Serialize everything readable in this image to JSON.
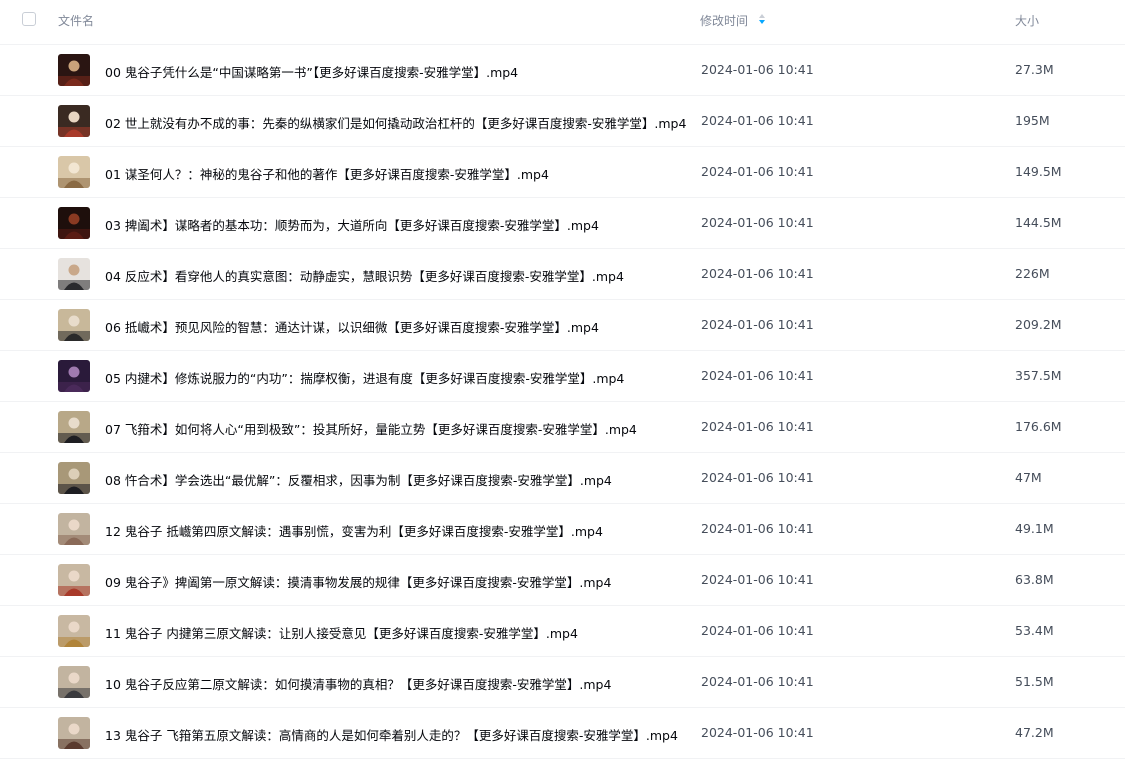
{
  "header": {
    "name_label": "文件名",
    "time_label": "修改时间",
    "size_label": "大小"
  },
  "files": [
    {
      "name": "00 鬼谷子凭什么是“中国谋略第一书”【更多好课百度搜索-安雅学堂】.mp4",
      "time": "2024-01-06 10:41",
      "size": "27.3M",
      "thumb": [
        "#2a1512",
        "#7a2a1c",
        "#c9a27a"
      ]
    },
    {
      "name": "02 世上就没有办不成的事：先秦的纵横家们是如何撬动政治杠杆的【更多好课百度搜索-安雅学堂】.mp4",
      "time": "2024-01-06 10:41",
      "size": "195M",
      "thumb": [
        "#3a2a22",
        "#a83a2a",
        "#e8d6c2"
      ]
    },
    {
      "name": "01 谋圣何人？：神秘的鬼谷子和他的著作【更多好课百度搜索-安雅学堂】.mp4",
      "time": "2024-01-06 10:41",
      "size": "149.5M",
      "thumb": [
        "#d9c7a8",
        "#8a6a44",
        "#f2e6d2"
      ]
    },
    {
      "name": "03 捭阖术】谋略者的基本功：顺势而为，大道所向【更多好课百度搜索-安雅学堂】.mp4",
      "time": "2024-01-06 10:41",
      "size": "144.5M",
      "thumb": [
        "#1e0f0c",
        "#5a1c14",
        "#8a3a22"
      ]
    },
    {
      "name": "04 反应术】看穿他人的真实意图：动静虚实，慧眼识势【更多好课百度搜索-安雅学堂】.mp4",
      "time": "2024-01-06 10:41",
      "size": "226M",
      "thumb": [
        "#e6e2de",
        "#2a2a2e",
        "#c9a88a"
      ]
    },
    {
      "name": "06 抵巇术】预见风险的智慧：通达计谋，以识细微【更多好课百度搜索-安雅学堂】.mp4",
      "time": "2024-01-06 10:41",
      "size": "209.2M",
      "thumb": [
        "#c8b89a",
        "#2a2a2a",
        "#e8dccb"
      ]
    },
    {
      "name": "05 内揵术】修炼说服力的“内功”：揣摩权衡，进退有度【更多好课百度搜索-安雅学堂】.mp4",
      "time": "2024-01-06 10:41",
      "size": "357.5M",
      "thumb": [
        "#2a1a3a",
        "#4a2a5a",
        "#a07ab0"
      ]
    },
    {
      "name": "07 飞箝术】如何将人心“用到极致”：投其所好，量能立势【更多好课百度搜索-安雅学堂】.mp4",
      "time": "2024-01-06 10:41",
      "size": "176.6M",
      "thumb": [
        "#b8a888",
        "#1e1e22",
        "#e8dccb"
      ]
    },
    {
      "name": "08 忤合术】学会选出“最优解”：反覆相求，因事为制【更多好课百度搜索-安雅学堂】.mp4",
      "time": "2024-01-06 10:41",
      "size": "47M",
      "thumb": [
        "#a89878",
        "#1e1e22",
        "#dccfb8"
      ]
    },
    {
      "name": "12 鬼谷子 抵巇第四原文解读：遇事别慌，变害为利【更多好课百度搜索-安雅学堂】.mp4",
      "time": "2024-01-06 10:41",
      "size": "49.1M",
      "thumb": [
        "#c2b4a0",
        "#8a6a58",
        "#ead8c8"
      ]
    },
    {
      "name": "09 鬼谷子》捭阖第一原文解读：摸清事物发展的规律【更多好课百度搜索-安雅学堂】.mp4",
      "time": "2024-01-06 10:41",
      "size": "63.8M",
      "thumb": [
        "#c8b8a2",
        "#a83a2a",
        "#ead8c8"
      ]
    },
    {
      "name": "11 鬼谷子 内揵第三原文解读：让别人接受意见【更多好课百度搜索-安雅学堂】.mp4",
      "time": "2024-01-06 10:41",
      "size": "53.4M",
      "thumb": [
        "#c8b8a2",
        "#b0843a",
        "#ead8c8"
      ]
    },
    {
      "name": "10 鬼谷子反应第二原文解读：如何摸清事物的真相？【更多好课百度搜索-安雅学堂】.mp4",
      "time": "2024-01-06 10:41",
      "size": "51.5M",
      "thumb": [
        "#c2b4a0",
        "#3a3a3e",
        "#ead8c8"
      ]
    },
    {
      "name": "13 鬼谷子 飞箝第五原文解读：高情商的人是如何牵着别人走的？【更多好课百度搜索-安雅学堂】.mp4",
      "time": "2024-01-06 10:41",
      "size": "47.2M",
      "thumb": [
        "#c2b4a0",
        "#5a3a2e",
        "#ead8c8"
      ]
    }
  ],
  "colors": {
    "sort_asc": "#c9ced6",
    "sort_desc": "#06a7ff"
  }
}
